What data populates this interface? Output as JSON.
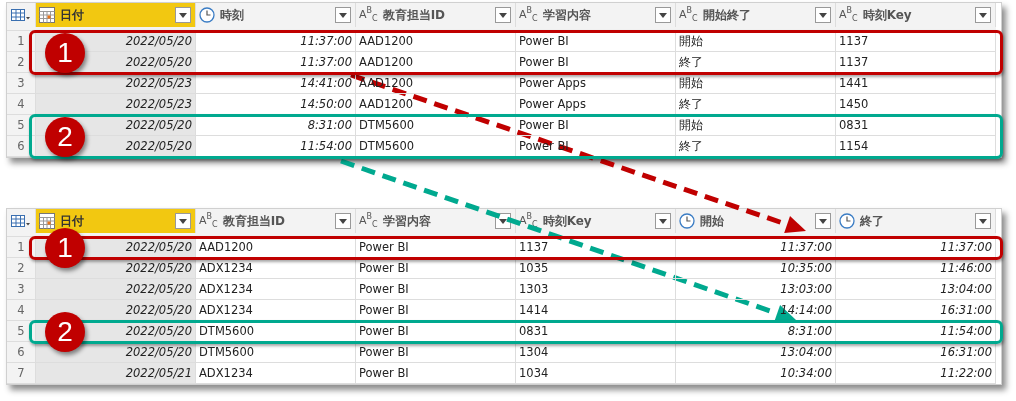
{
  "tables": [
    {
      "columns": [
        {
          "kind": "date",
          "label": "日付",
          "selected": true
        },
        {
          "kind": "time",
          "label": "時刻",
          "selected": false
        },
        {
          "kind": "text",
          "type_label": "A$^{B}$$_{C}$",
          "label": "教育担当ID",
          "selected": false
        },
        {
          "kind": "text",
          "type_label": "A$^{B}$$_{C}$",
          "label": "学習内容",
          "selected": false
        },
        {
          "kind": "text",
          "type_label": "A$^{B}$$_{C}$",
          "label": "開始終了",
          "selected": false
        },
        {
          "kind": "text",
          "type_label": "A$^{B}$$_{C}$",
          "label": "時刻Key",
          "selected": false
        }
      ],
      "highlights": [
        {
          "number": "1",
          "color": "#c00000"
        },
        {
          "number": "2",
          "color": "#00a98f"
        }
      ],
      "rows": [
        {
          "number": "1",
          "framed": true,
          "cells": [
            "2022/05/20",
            "11:37:00",
            "AAD1200",
            "Power BI",
            "開始",
            "1137"
          ]
        },
        {
          "number": "2",
          "framed": true,
          "cells": [
            "2022/05/20",
            "11:37:00",
            "AAD1200",
            "Power BI",
            "終了",
            "1137"
          ]
        },
        {
          "number": "3",
          "cells": [
            "2022/05/23",
            "14:41:00",
            "AAD1200",
            "Power Apps",
            "開始",
            "1441"
          ]
        },
        {
          "number": "4",
          "cells": [
            "2022/05/23",
            "14:50:00",
            "AAD1200",
            "Power Apps",
            "終了",
            "1450"
          ]
        },
        {
          "number": "5",
          "framed": true,
          "cells": [
            "2022/05/20",
            "8:31:00",
            "DTM5600",
            "Power BI",
            "開始",
            "0831"
          ]
        },
        {
          "number": "6",
          "framed": true,
          "cells": [
            "2022/05/20",
            "11:54:00",
            "DTM5600",
            "Power BI",
            "終了",
            "1154"
          ]
        }
      ]
    },
    {
      "columns": [
        {
          "kind": "date",
          "label": "日付",
          "selected": true
        },
        {
          "kind": "text",
          "type_label": "A$^{B}$$_{C}$",
          "label": "教育担当ID",
          "selected": false
        },
        {
          "kind": "text",
          "type_label": "A$^{B}$$_{C}$",
          "label": "学習内容",
          "selected": false
        },
        {
          "kind": "text",
          "type_label": "A$^{B}$$_{C}$",
          "label": "時刻Key",
          "selected": false
        },
        {
          "kind": "time",
          "label": "開始",
          "selected": false
        },
        {
          "kind": "time",
          "label": "終了",
          "selected": false
        }
      ],
      "highlights": [
        {
          "number": "1",
          "color": "#c00000"
        },
        {
          "number": "2",
          "color": "#00a98f"
        }
      ],
      "rows": [
        {
          "number": "1",
          "framed": true,
          "cells": [
            "2022/05/20",
            "AAD1200",
            "Power BI",
            "1137",
            "11:37:00",
            "11:37:00"
          ]
        },
        {
          "number": "2",
          "cells": [
            "2022/05/20",
            "ADX1234",
            "Power BI",
            "1035",
            "10:35:00",
            "11:46:00"
          ]
        },
        {
          "number": "3",
          "cells": [
            "2022/05/20",
            "ADX1234",
            "Power BI",
            "1303",
            "13:03:00",
            "13:04:00"
          ]
        },
        {
          "number": "4",
          "cells": [
            "2022/05/20",
            "ADX1234",
            "Power BI",
            "1414",
            "14:14:00",
            "16:31:00"
          ]
        },
        {
          "number": "5",
          "framed": true,
          "cells": [
            "2022/05/20",
            "DTM5600",
            "Power BI",
            "0831",
            "8:31:00",
            "11:54:00"
          ]
        },
        {
          "number": "6",
          "cells": [
            "2022/05/20",
            "DTM5600",
            "Power BI",
            "1304",
            "13:04:00",
            "16:31:00"
          ]
        },
        {
          "number": "7",
          "cells": [
            "2022/05/21",
            "ADX1234",
            "Power BI",
            "1034",
            "10:34:00",
            "11:22:00"
          ]
        }
      ]
    }
  ],
  "arrows": [
    {
      "color": "#c00000"
    },
    {
      "color": "#00a98f"
    }
  ]
}
